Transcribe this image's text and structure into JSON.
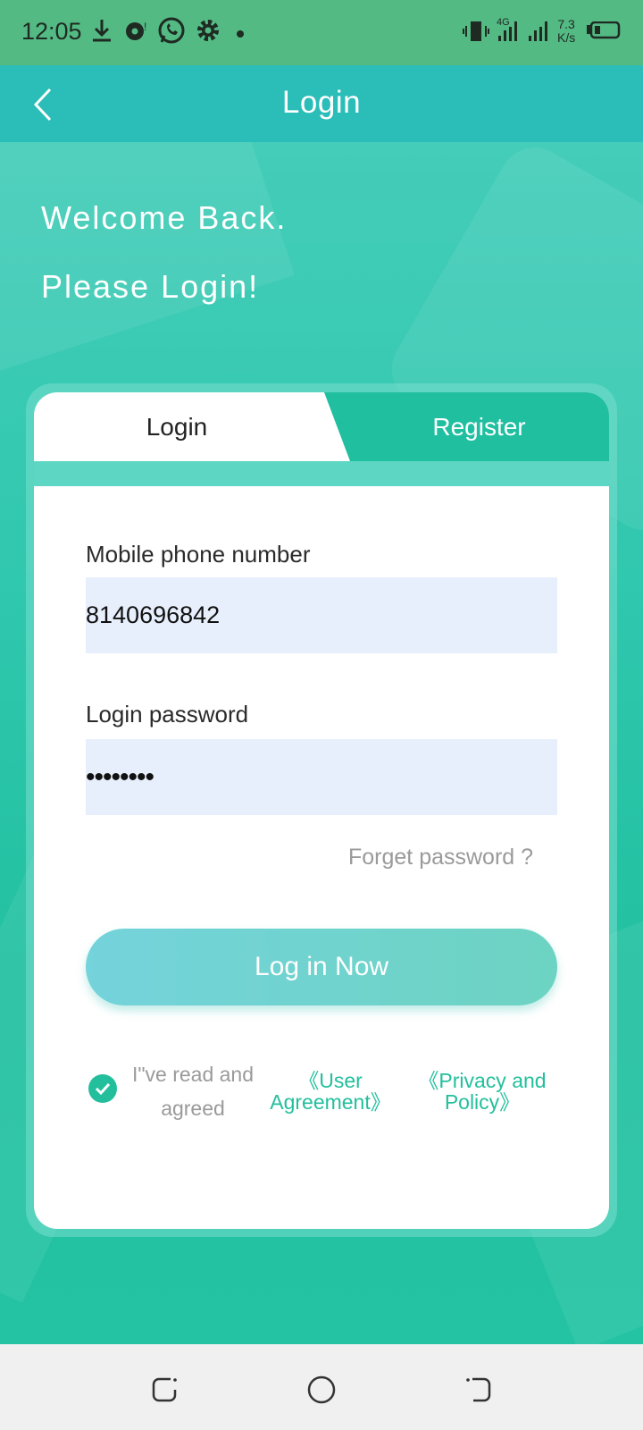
{
  "status_bar": {
    "time": "12:05",
    "network_speed_value": "7.3",
    "network_speed_unit": "K/s",
    "network_type": "4G",
    "icons": [
      "download-icon",
      "sync-icon",
      "whatsapp-icon",
      "settings-icon",
      "dot-icon",
      "vibrate-icon",
      "signal-icon",
      "battery-icon"
    ]
  },
  "app_bar": {
    "title": "Login",
    "back_icon": "chevron-left-icon"
  },
  "welcome": {
    "line1": "Welcome Back.",
    "line2": "Please Login!"
  },
  "tabs": {
    "login": "Login",
    "register": "Register",
    "active": "login"
  },
  "form": {
    "phone_label": "Mobile phone number",
    "phone_value": "8140696842",
    "password_label": "Login password",
    "password_value": "••••••••",
    "forget_password": "Forget password ?",
    "login_button": "Log in Now",
    "agree_text": "I\"ve read and agreed",
    "user_agreement_line1": "《User",
    "user_agreement_line2": "Agreement》",
    "privacy_line1": "《Privacy and",
    "privacy_line2": "Policy》",
    "agree_checked": true
  },
  "colors": {
    "status_bar": "#54ba84",
    "app_bar": "#2bbdb8",
    "accent": "#1fbfa0",
    "input_bg": "#e8effc",
    "link": "#23bf9c"
  },
  "nav_bar": {
    "icons": [
      "recent-apps-icon",
      "home-icon",
      "back-nav-icon"
    ]
  }
}
